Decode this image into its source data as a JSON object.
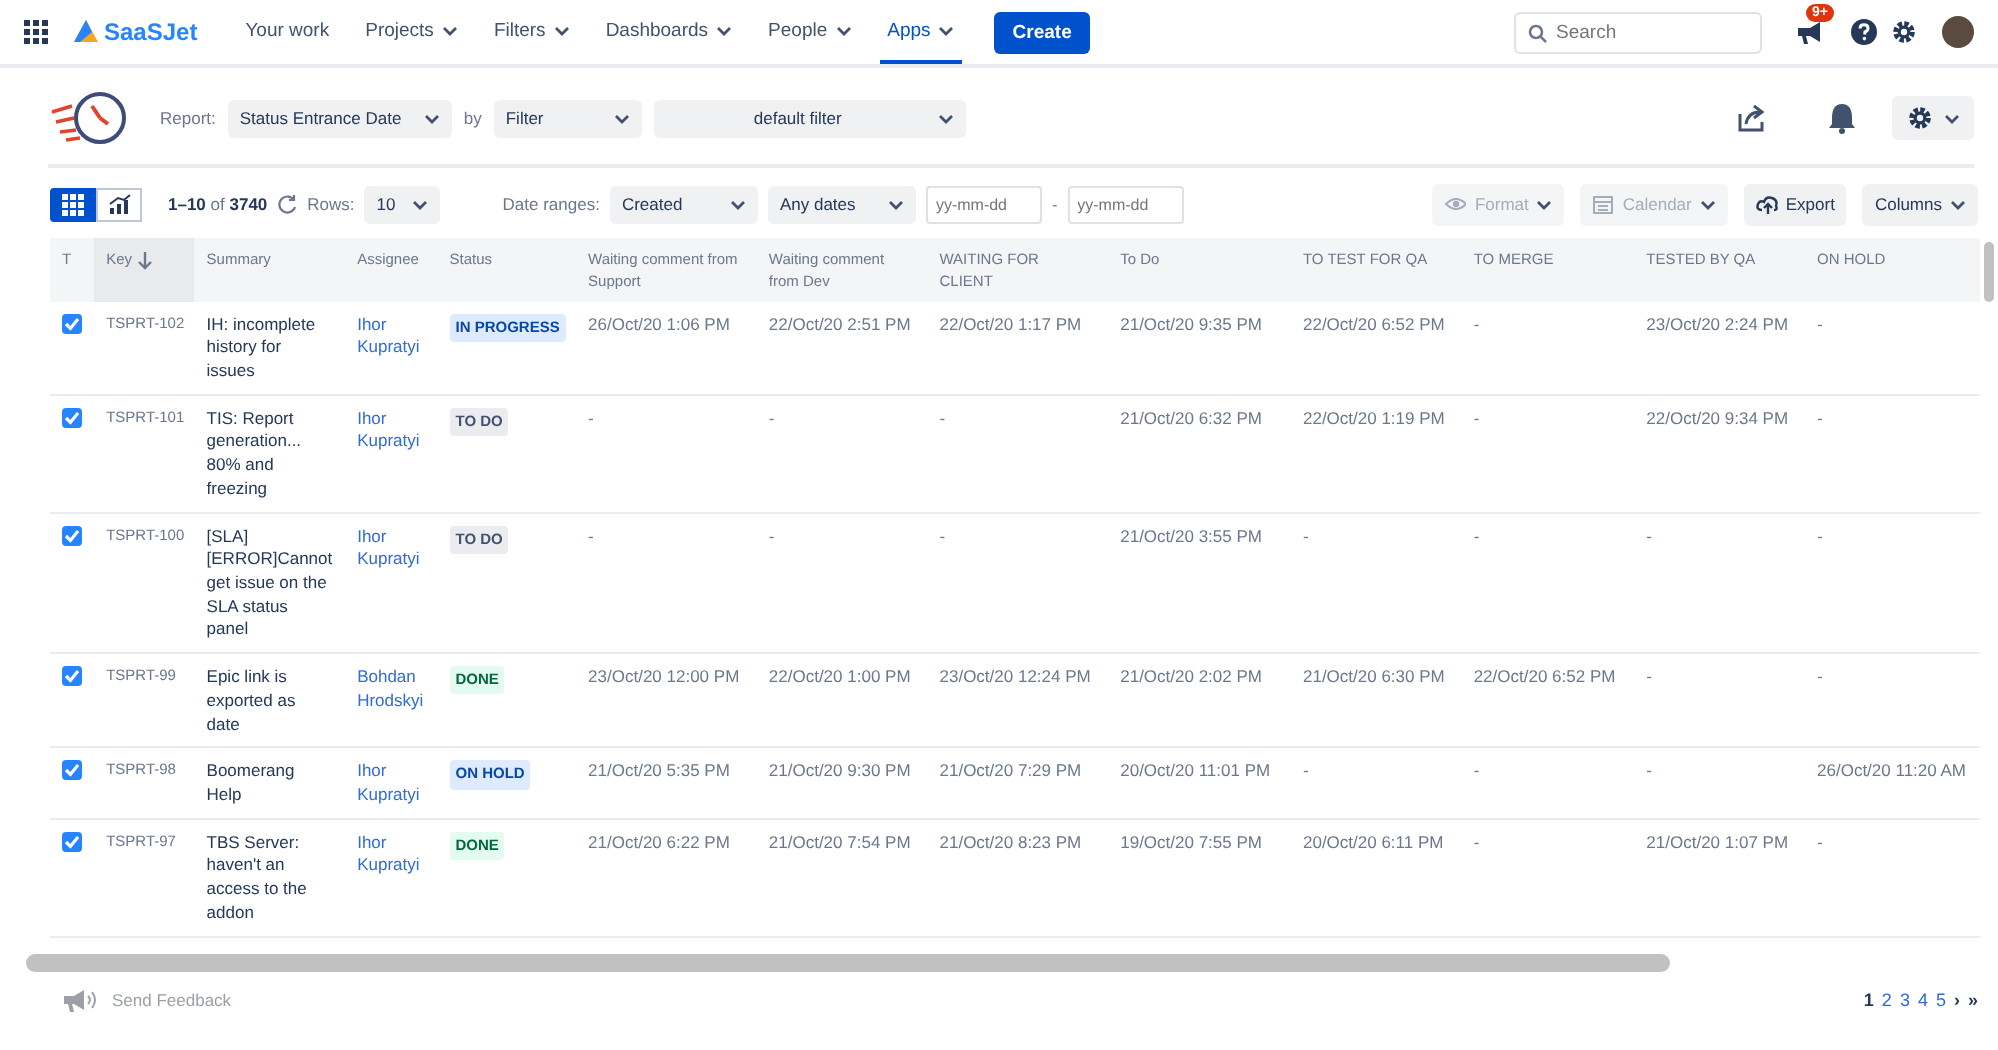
{
  "nav": {
    "brand": "SaaSJet",
    "items": [
      {
        "label": "Your work",
        "dropdown": false,
        "selected": false
      },
      {
        "label": "Projects",
        "dropdown": true,
        "selected": false
      },
      {
        "label": "Filters",
        "dropdown": true,
        "selected": false
      },
      {
        "label": "Dashboards",
        "dropdown": true,
        "selected": false
      },
      {
        "label": "People",
        "dropdown": true,
        "selected": false
      },
      {
        "label": "Apps",
        "dropdown": true,
        "selected": true
      }
    ],
    "create": "Create",
    "search": {
      "placeholder": "Search"
    },
    "notification_badge": "9+"
  },
  "report_bar": {
    "report_label": "Report:",
    "report": "Status Entrance Date",
    "by_label": "by",
    "by": "Filter",
    "filter": "default filter"
  },
  "toolbar": {
    "views": [
      {
        "kind": "grid",
        "selected": true
      },
      {
        "kind": "chart",
        "selected": false
      }
    ],
    "range_text": "1–10",
    "of_text": "of",
    "total": "3740",
    "rows_label": "Rows:",
    "rows": "10",
    "date_ranges_label": "Date ranges:",
    "date_field": "Created",
    "date_preset": "Any dates",
    "from": {
      "placeholder": "yy-mm-dd"
    },
    "separator": "-",
    "to": {
      "placeholder": "yy-mm-dd"
    },
    "buttons": [
      {
        "kind": "format",
        "label": "Format",
        "disabled": true
      },
      {
        "kind": "calendar",
        "label": "Calendar",
        "disabled": true
      },
      {
        "kind": "export",
        "label": "Export",
        "disabled": false
      },
      {
        "kind": "columns",
        "label": "Columns",
        "disabled": false
      }
    ]
  },
  "table": {
    "columns": [
      {
        "label": "T",
        "sorted": false
      },
      {
        "label": "Key",
        "sorted": true
      },
      {
        "label": "Summary",
        "sorted": false
      },
      {
        "label": "Assignee",
        "sorted": false
      },
      {
        "label": "Status",
        "sorted": false
      },
      {
        "label": "Waiting comment from Support",
        "sorted": false
      },
      {
        "label": "Waiting comment from Dev",
        "sorted": false
      },
      {
        "label": "WAITING FOR CLIENT",
        "sorted": false
      },
      {
        "label": "To Do",
        "sorted": false
      },
      {
        "label": "TO TEST FOR QA",
        "sorted": false
      },
      {
        "label": "TO MERGE",
        "sorted": false
      },
      {
        "label": "TESTED BY QA",
        "sorted": false
      },
      {
        "label": "ON HOLD",
        "sorted": false
      }
    ],
    "rows": [
      {
        "checked": true,
        "key": "TSPRT-102",
        "summary": "IH: incomplete history for issues",
        "assignee": "Ihor Kupratyi",
        "status": {
          "label": "IN PROGRESS",
          "kind": "inprogress"
        },
        "dates": [
          "26/Oct/20 1:06 PM",
          "22/Oct/20 2:51 PM",
          "22/Oct/20 1:17 PM",
          "21/Oct/20 9:35 PM",
          "22/Oct/20 6:52 PM",
          "-",
          "23/Oct/20 2:24 PM",
          "-"
        ]
      },
      {
        "checked": true,
        "key": "TSPRT-101",
        "summary": "TIS: Report generation... 80% and freezing",
        "assignee": "Ihor Kupratyi",
        "status": {
          "label": "TO DO",
          "kind": "todo"
        },
        "dates": [
          "-",
          "-",
          "-",
          "21/Oct/20 6:32 PM",
          "22/Oct/20 1:19 PM",
          "-",
          "22/Oct/20 9:34 PM",
          "-"
        ]
      },
      {
        "checked": true,
        "key": "TSPRT-100",
        "summary": "[SLA] [ERROR]Cannot get issue on the SLA status panel",
        "assignee": "Ihor Kupratyi",
        "status": {
          "label": "TO DO",
          "kind": "todo"
        },
        "dates": [
          "-",
          "-",
          "-",
          "21/Oct/20 3:55 PM",
          "-",
          "-",
          "-",
          "-"
        ]
      },
      {
        "checked": true,
        "key": "TSPRT-99",
        "summary": "Epic link is exported as date",
        "assignee": "Bohdan Hrodskyi",
        "status": {
          "label": "DONE",
          "kind": "done"
        },
        "dates": [
          "23/Oct/20 12:00 PM",
          "22/Oct/20 1:00 PM",
          "23/Oct/20 12:24 PM",
          "21/Oct/20 2:02 PM",
          "21/Oct/20 6:30 PM",
          "22/Oct/20 6:52 PM",
          "-",
          "-"
        ]
      },
      {
        "checked": true,
        "key": "TSPRT-98",
        "summary": "Boomerang Help",
        "assignee": "Ihor Kupratyi",
        "status": {
          "label": "ON HOLD",
          "kind": "onhold"
        },
        "dates": [
          "21/Oct/20 5:35 PM",
          "21/Oct/20 9:30 PM",
          "21/Oct/20 7:29 PM",
          "20/Oct/20 11:01 PM",
          "-",
          "-",
          "-",
          "26/Oct/20 11:20 AM"
        ]
      },
      {
        "checked": true,
        "key": "TSPRT-97",
        "summary": "TBS Server: haven't an access to the addon",
        "assignee": "Ihor Kupratyi",
        "status": {
          "label": "DONE",
          "kind": "done"
        },
        "dates": [
          "21/Oct/20 6:22 PM",
          "21/Oct/20 7:54 PM",
          "21/Oct/20 8:23 PM",
          "19/Oct/20 7:55 PM",
          "20/Oct/20 6:11 PM",
          "-",
          "21/Oct/20 1:07 PM",
          "-"
        ]
      }
    ]
  },
  "footer": {
    "feedback": "Send Feedback",
    "pages": [
      {
        "label": "1",
        "selected": true
      },
      {
        "label": "2",
        "selected": false
      },
      {
        "label": "3",
        "selected": false
      },
      {
        "label": "4",
        "selected": false
      },
      {
        "label": "5",
        "selected": false
      }
    ],
    "next": "›",
    "last": "»"
  }
}
